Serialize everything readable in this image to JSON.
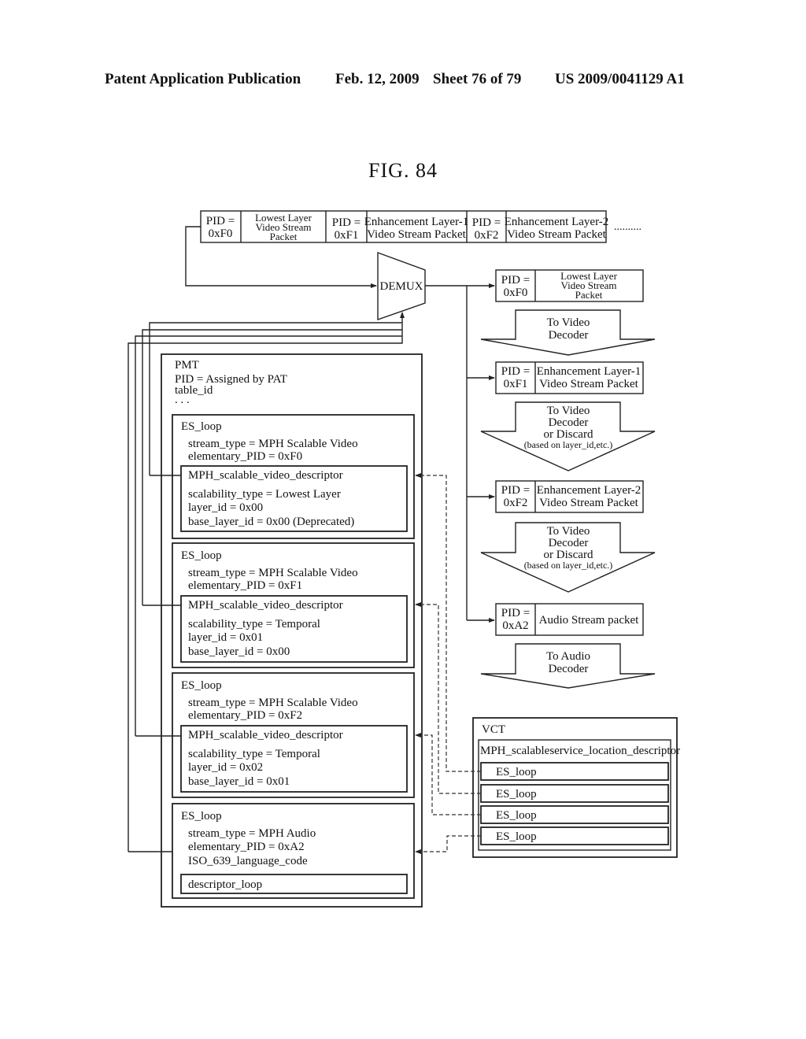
{
  "header": {
    "publication": "Patent Application Publication",
    "date_sheet": "Feb. 12, 2009",
    "sheet": "Sheet 76 of 79",
    "number": "US 2009/0041129 A1"
  },
  "figure": {
    "title": "FIG. 84"
  },
  "input_stream": {
    "packets": [
      {
        "pid_label": "PID =",
        "pid": "0xF0",
        "payload": [
          "Lowest Layer",
          "Video Stream",
          "Packet"
        ]
      },
      {
        "pid_label": "PID =",
        "pid": "0xF1",
        "payload": [
          "Enhancement Layer-1",
          "Video Stream Packet"
        ]
      },
      {
        "pid_label": "PID =",
        "pid": "0xF2",
        "payload": [
          "Enhancement Layer-2",
          "Video Stream Packet"
        ]
      }
    ],
    "ellipsis": ".........."
  },
  "demux": {
    "label": "DEMUX"
  },
  "outputs": [
    {
      "pid_label": "PID =",
      "pid": "0xF0",
      "payload": [
        "Lowest Layer",
        "Video Stream",
        "Packet"
      ],
      "arrow": [
        "To Video",
        "Decoder"
      ]
    },
    {
      "pid_label": "PID =",
      "pid": "0xF1",
      "payload": [
        "Enhancement Layer-1",
        "Video Stream Packet"
      ],
      "arrow": [
        "To Video",
        "Decoder",
        "or Discard",
        "(based on layer_id,etc.)"
      ]
    },
    {
      "pid_label": "PID =",
      "pid": "0xF2",
      "payload": [
        "Enhancement Layer-2",
        "Video Stream Packet"
      ],
      "arrow": [
        "To Video",
        "Decoder",
        "or Discard",
        "(based on layer_id,etc.)"
      ]
    },
    {
      "pid_label": "PID =",
      "pid": "0xA2",
      "payload": [
        "Audio Stream packet"
      ],
      "arrow": [
        "To Audio",
        "Decoder"
      ]
    }
  ],
  "pmt": {
    "title": "PMT",
    "lines": [
      "PID = Assigned by PAT",
      "table_id",
      ". . ."
    ],
    "es_loops": [
      {
        "title": "ES_loop",
        "lines": [
          "stream_type = MPH Scalable Video",
          "elementary_PID = 0xF0"
        ],
        "descriptor": {
          "title": "MPH_scalable_video_descriptor",
          "lines": [
            "scalability_type = Lowest Layer",
            "layer_id = 0x00",
            "base_layer_id = 0x00 (Deprecated)"
          ]
        }
      },
      {
        "title": "ES_loop",
        "lines": [
          "stream_type = MPH Scalable Video",
          "elementary_PID = 0xF1"
        ],
        "descriptor": {
          "title": "MPH_scalable_video_descriptor",
          "lines": [
            "scalability_type = Temporal",
            "layer_id = 0x01",
            "base_layer_id = 0x00"
          ]
        }
      },
      {
        "title": "ES_loop",
        "lines": [
          "stream_type = MPH Scalable Video",
          "elementary_PID = 0xF2"
        ],
        "descriptor": {
          "title": "MPH_scalable_video_descriptor",
          "lines": [
            "scalability_type = Temporal",
            "layer_id = 0x02",
            "base_layer_id = 0x01"
          ]
        }
      },
      {
        "title": "ES_loop",
        "lines": [
          "stream_type = MPH Audio",
          "elementary_PID = 0xA2",
          "ISO_639_language_code"
        ],
        "descriptor": {
          "title": "descriptor_loop",
          "lines": []
        }
      }
    ]
  },
  "vct": {
    "title": "VCT",
    "descriptor": "MPH_scalableservice_location_descriptor",
    "es_loops": [
      "ES_loop",
      "ES_loop",
      "ES_loop",
      "ES_loop"
    ]
  }
}
